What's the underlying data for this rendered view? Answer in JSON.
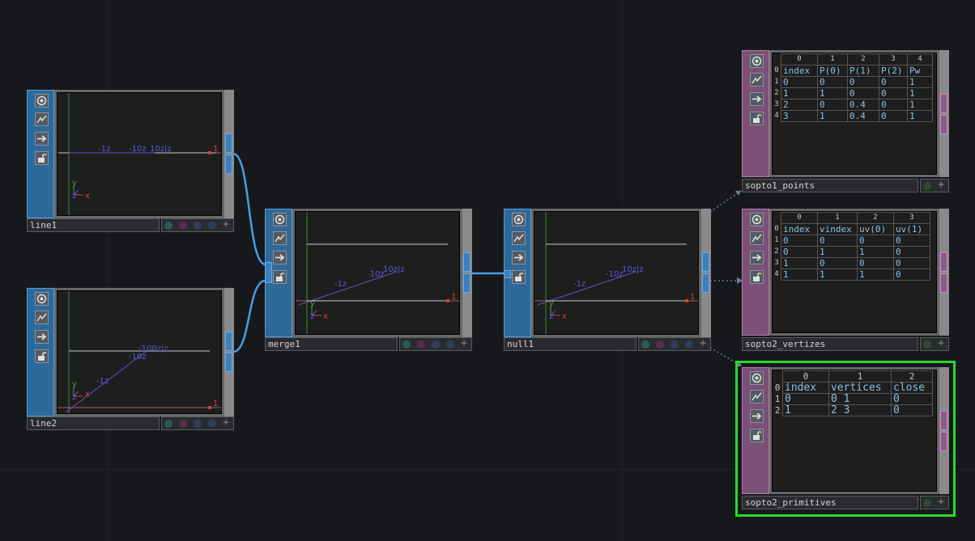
{
  "nodes": {
    "line1": {
      "name": "line1",
      "labels": {
        "neg1z": "-1z",
        "neg10z": "-10z",
        "zz": "10z|z",
        "one": "1",
        "y": "y",
        "z": "z",
        "x": "x"
      }
    },
    "line2": {
      "name": "line2",
      "labels": {
        "top": "-100z|z",
        "neg10z": "-10z",
        "neg1z": "-1z",
        "y": "y",
        "z": "z",
        "x": "x",
        "one": "1"
      }
    },
    "merge1": {
      "name": "merge1",
      "labels": {
        "neg1z": "-1z",
        "neg10z": "-10z",
        "zz": "10z|z",
        "one": "1",
        "y": "y",
        "z": "z",
        "x": "x"
      }
    },
    "null1": {
      "name": "null1",
      "labels": {
        "neg1z": "-1z",
        "neg10z": "-10z",
        "zz": "10z|z",
        "one": "1",
        "y": "y",
        "z": "z",
        "x": "x"
      }
    },
    "sopto1_points": {
      "name": "sopto1_points",
      "col_numbers": [
        "0",
        "1",
        "2",
        "3",
        "4"
      ],
      "row_numbers": [
        "0",
        "1",
        "2",
        "3",
        "4"
      ],
      "rows": [
        [
          "index",
          "P(0)",
          "P(1)",
          "P(2)",
          "Pw"
        ],
        [
          "0",
          "0",
          "0",
          "0",
          "1"
        ],
        [
          "1",
          "1",
          "0",
          "0",
          "1"
        ],
        [
          "2",
          "0",
          "0.4",
          "0",
          "1"
        ],
        [
          "3",
          "1",
          "0.4",
          "0",
          "1"
        ]
      ]
    },
    "sopto2_vertizes": {
      "name": "sopto2_vertizes",
      "col_numbers": [
        "0",
        "1",
        "2",
        "3"
      ],
      "row_numbers": [
        "0",
        "1",
        "2",
        "3",
        "4"
      ],
      "rows": [
        [
          "index",
          "vindex",
          "uv(0)",
          "uv(1)"
        ],
        [
          "0",
          "0",
          "0",
          "0"
        ],
        [
          "0",
          "1",
          "1",
          "0"
        ],
        [
          "1",
          "0",
          "0",
          "0"
        ],
        [
          "1",
          "1",
          "1",
          "0"
        ]
      ]
    },
    "sopto2_primitives": {
      "name": "sopto2_primitives",
      "col_numbers": [
        "0",
        "1",
        "2"
      ],
      "row_numbers": [
        "0",
        "1",
        "2"
      ],
      "rows": [
        [
          "index",
          "vertices",
          "close"
        ],
        [
          "0",
          "0 1",
          "0"
        ],
        [
          "1",
          "2 3",
          "0"
        ]
      ]
    }
  },
  "colors": {
    "background": "#17181c",
    "sop_family": "#2d6a9b",
    "dat_family": "#7b4f77",
    "sop_wire": "#4a9ee6",
    "dat_link": "#6e7f8e",
    "selection": "#2bd92b",
    "axis_x": "#d04040",
    "axis_y": "#3fa33f",
    "axis_z": "#5b5bd6"
  },
  "icons": [
    "viewer-toggle-icon",
    "cook-icon",
    "export-icon",
    "lock-icon",
    "plus-icon"
  ]
}
